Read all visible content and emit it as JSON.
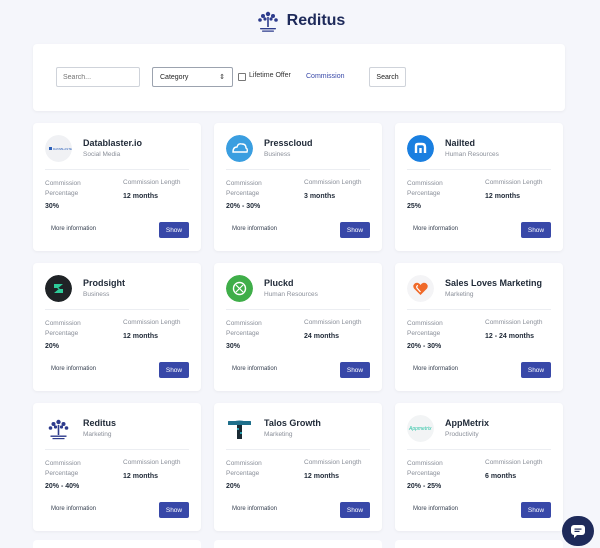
{
  "brand": {
    "name": "Reditus",
    "logo_icon": "tree-logo-icon"
  },
  "filters": {
    "search_placeholder": "Search...",
    "category_label": "Category",
    "lifetime_label": "Lifetime Offer",
    "commission_link": "Commission",
    "search_button": "Search"
  },
  "labels": {
    "commission_percentage": "Commission Percentage",
    "commission_length": "Commission Length",
    "more_information": "More information",
    "show": "Show"
  },
  "cards": [
    {
      "name": "Datablaster.io",
      "category": "Social Media",
      "percentage": "30%",
      "length": "12 months",
      "logo": "datablaster-logo-icon"
    },
    {
      "name": "Presscloud",
      "category": "Business",
      "percentage": "20% - 30%",
      "length": "3 months",
      "logo": "cloud-logo-icon"
    },
    {
      "name": "Nailted",
      "category": "Human Resources",
      "percentage": "25%",
      "length": "12 months",
      "logo": "nailted-logo-icon"
    },
    {
      "name": "Prodsight",
      "category": "Business",
      "percentage": "20%",
      "length": "12 months",
      "logo": "prodsight-logo-icon"
    },
    {
      "name": "Pluckd",
      "category": "Human Resources",
      "percentage": "30%",
      "length": "24 months",
      "logo": "pluckd-logo-icon"
    },
    {
      "name": "Sales Loves Marketing",
      "category": "Marketing",
      "percentage": "20% - 30%",
      "length": "12 - 24 months",
      "logo": "heart-logo-icon"
    },
    {
      "name": "Reditus",
      "category": "Marketing",
      "percentage": "20% - 40%",
      "length": "12 months",
      "logo": "tree-logo-icon"
    },
    {
      "name": "Talos Growth",
      "category": "Marketing",
      "percentage": "20%",
      "length": "12 months",
      "logo": "talos-logo-icon"
    },
    {
      "name": "AppMetrix",
      "category": "Productivity",
      "percentage": "20% - 25%",
      "length": "6 months",
      "logo": "appmetrix-logo-icon"
    }
  ],
  "logo_texts": {
    "datablaster": "DATABLASTER",
    "appmetrix": "Appmetrix"
  },
  "colors": {
    "accent": "#3848a8",
    "brand": "#1e2a5a"
  },
  "chat": {
    "icon": "chat-icon"
  }
}
